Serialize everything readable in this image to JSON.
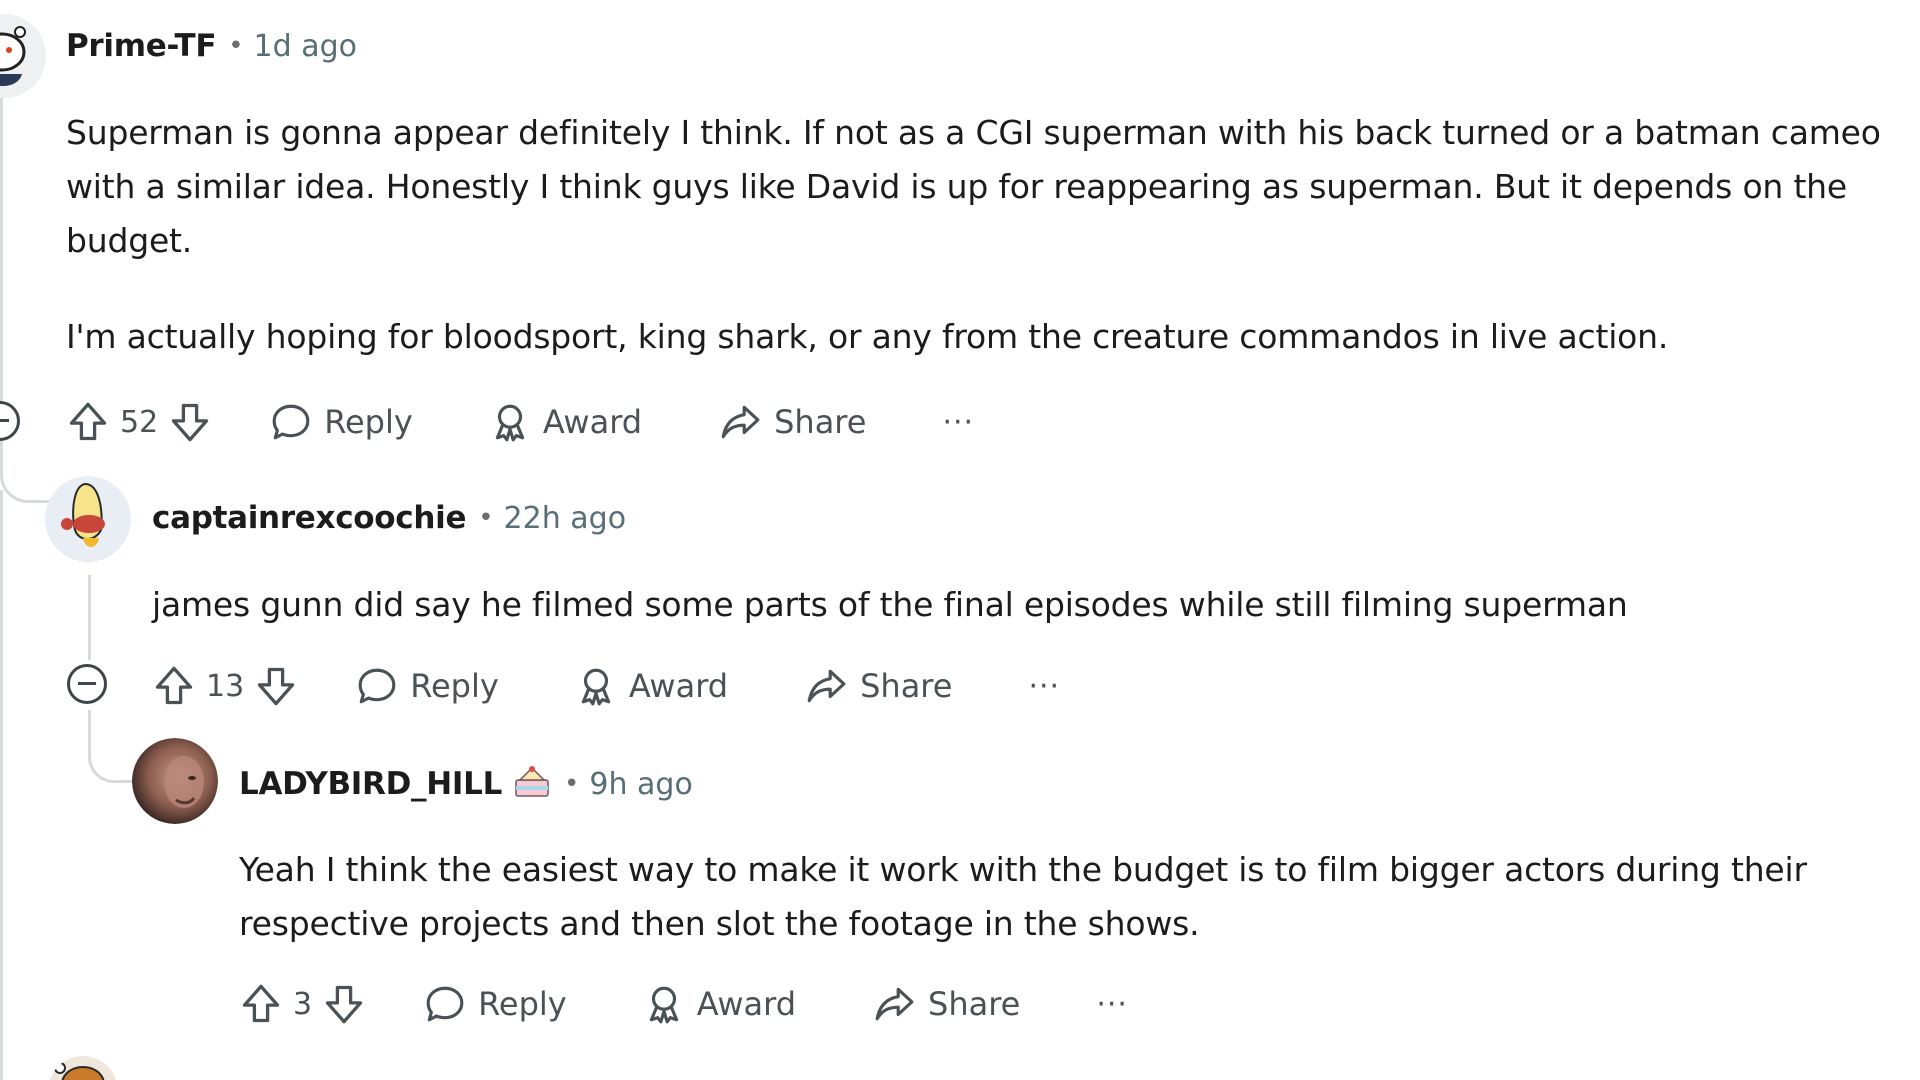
{
  "comments": [
    {
      "author": "Prime-TF",
      "time": "1d ago",
      "paragraphs": [
        "Superman is gonna appear definitely I think. If not as a CGI superman with his back turned or a batman cameo with a similar idea. Honestly I think guys like David is up for reappearing as superman. But it depends on the budget.",
        "I'm actually hoping for bloodsport, king shark, or any from the creature commandos in live action."
      ],
      "score": "52",
      "reply_label": "Reply",
      "award_label": "Award",
      "share_label": "Share",
      "more_label": "···"
    },
    {
      "author": "captainrexcoochie",
      "time": "22h ago",
      "paragraphs": [
        "james gunn did say he filmed some parts of the final episodes while still filming superman"
      ],
      "score": "13",
      "reply_label": "Reply",
      "award_label": "Award",
      "share_label": "Share",
      "more_label": "···"
    },
    {
      "author": "LADYBIRD_HILL",
      "time": "9h ago",
      "paragraphs": [
        "Yeah I think the easiest way to make it work with the budget is to film bigger actors during their respective projects and then slot the footage in the shows."
      ],
      "score": "3",
      "reply_label": "Reply",
      "award_label": "Award",
      "share_label": "Share",
      "more_label": "···"
    }
  ],
  "separator": "•",
  "colors": {
    "text": "#1c1c1c",
    "meta": "#576f76",
    "action": "#4a5256",
    "rail": "#d7dadc"
  }
}
